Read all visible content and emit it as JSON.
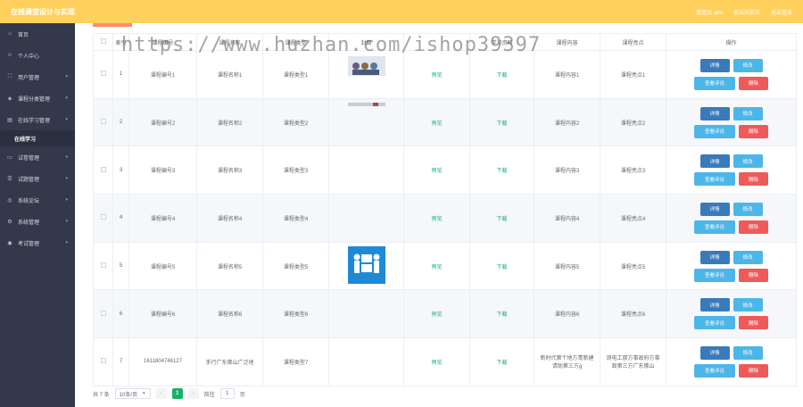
{
  "header": {
    "title": "在线课堂设计与实现",
    "user": "管理员 abo",
    "frontend": "退出到前台",
    "logout": "退出登录"
  },
  "watermark": "https://www.huzhan.com/ishop39397",
  "sidebar": {
    "items": [
      {
        "label": "首页",
        "icon": "home-icon"
      },
      {
        "label": "个人中心",
        "icon": "user-icon"
      },
      {
        "label": "用户管理",
        "icon": "users-icon"
      },
      {
        "label": "课程分类管理",
        "icon": "tag-icon"
      },
      {
        "label": "在线学习管理",
        "icon": "book-icon"
      },
      {
        "label": "在线学习",
        "sub": true
      },
      {
        "label": "试卷管理",
        "icon": "file-icon"
      },
      {
        "label": "试题管理",
        "icon": "list-icon"
      },
      {
        "label": "系统论坛",
        "icon": "chat-icon"
      },
      {
        "label": "系统管理",
        "icon": "gear-icon"
      },
      {
        "label": "考试管理",
        "icon": "exam-icon"
      }
    ]
  },
  "table": {
    "columns": [
      "",
      "索引",
      "课程编号",
      "课程名称",
      "课程类型",
      "封面",
      "",
      "学习资料",
      "课程内容",
      "课程亮点",
      "操作"
    ],
    "rows": [
      {
        "idx": "1",
        "code": "课程编号1",
        "name": "课程名称1",
        "type": "课程类型1",
        "cover": "cover-a",
        "video": "预览",
        "material": "下载",
        "content": "课程内容1",
        "highlight": "课程亮点1"
      },
      {
        "idx": "2",
        "code": "课程编号2",
        "name": "课程名称2",
        "type": "课程类型2",
        "cover": "cover-b",
        "video": "预览",
        "material": "下载",
        "content": "课程内容2",
        "highlight": "课程亮点2"
      },
      {
        "idx": "3",
        "code": "课程编号3",
        "name": "课程名称3",
        "type": "课程类型3",
        "cover": "",
        "video": "预览",
        "material": "下载",
        "content": "课程内容3",
        "highlight": "课程亮点3"
      },
      {
        "idx": "4",
        "code": "课程编号4",
        "name": "课程名称4",
        "type": "课程类型4",
        "cover": "",
        "video": "预览",
        "material": "下载",
        "content": "课程内容4",
        "highlight": "课程亮点4"
      },
      {
        "idx": "5",
        "code": "课程编号5",
        "name": "课程名称5",
        "type": "课程类型5",
        "cover": "cover-c",
        "video": "预览",
        "material": "下载",
        "content": "课程内容5",
        "highlight": "课程亮点5"
      },
      {
        "idx": "6",
        "code": "课程编号6",
        "name": "课程名称6",
        "type": "课程类型6",
        "cover": "",
        "video": "预览",
        "material": "下载",
        "content": "课程内容6",
        "highlight": "课程亮点6"
      },
      {
        "idx": "7",
        "code": "1611804746127",
        "name": "手行广东佛山广泛地",
        "type": "课程类型7",
        "cover": "",
        "video": "预览",
        "material": "下载",
        "content": "新时代第个地方青新建请助第三方g",
        "highlight": "测电工那方事政府方事政第三方广东佛山"
      }
    ],
    "actions": {
      "detail": "详情",
      "edit": "修改",
      "comment": "查看评论",
      "delete": "删除"
    }
  },
  "pager": {
    "total": "共 7 条",
    "page_size": "10条/页",
    "current": "1",
    "goto_label": "前往",
    "goto_value": "1",
    "page_unit": "页"
  },
  "colors": {
    "header": "#ffd15c",
    "sidebar": "#33384a",
    "accent": "#17b16a",
    "detail": "#3a7ab8",
    "edit": "#4db6e8",
    "delete": "#ee5a5a"
  }
}
